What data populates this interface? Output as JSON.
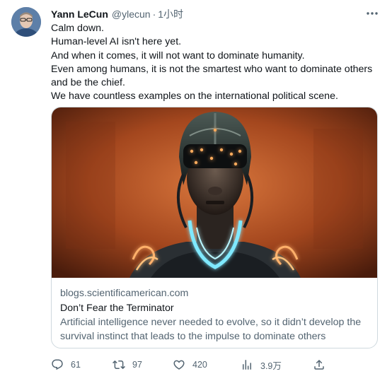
{
  "tweet": {
    "author_name": "Yann LeCun",
    "author_handle": "@ylecun",
    "separator": "·",
    "timestamp": "1小时",
    "text_lines": [
      "Calm down.",
      "Human-level AI isn't here yet.",
      "And when it comes, it will not want to dominate humanity.",
      "Even among humans, it is not the smartest who want to dominate others",
      "and be the chief.",
      "We have countless examples on the international political scene."
    ]
  },
  "card": {
    "domain": "blogs.scientificamerican.com",
    "title": "Don’t Fear the Terminator",
    "description": "Artificial intelligence never needed to evolve, so it didn’t develop the survival instinct that leads to the impulse to dominate others"
  },
  "actions": {
    "replies": "61",
    "retweets": "97",
    "likes": "420",
    "views": "3.9万"
  },
  "icons": {
    "more": "more-horizontal-icon",
    "reply": "reply-icon",
    "retweet": "retweet-icon",
    "like": "heart-icon",
    "views": "views-chart-icon",
    "share": "share-icon"
  },
  "colors": {
    "text_primary": "#0f1419",
    "text_secondary": "#536471",
    "border": "#cfd9de",
    "neon": "#7fe9ff"
  }
}
